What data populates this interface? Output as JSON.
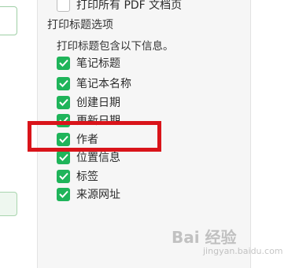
{
  "settings": {
    "top_option": {
      "label": "打印所有 PDF 文档页",
      "checked": false
    },
    "section_title": "打印标题选项",
    "section_desc": "打印标题包含以下信息。",
    "options": [
      {
        "label": "笔记标题",
        "checked": true
      },
      {
        "label": "笔记本名称",
        "checked": true
      },
      {
        "label": "创建日期",
        "checked": true
      },
      {
        "label": "更新日期",
        "checked": true
      },
      {
        "label": "作者",
        "checked": true
      },
      {
        "label": "位置信息",
        "checked": true
      },
      {
        "label": "标签",
        "checked": true
      },
      {
        "label": "来源网址",
        "checked": true
      }
    ]
  },
  "watermark": {
    "text": "Bai 经验",
    "sub": "jingyan.baidu.com"
  },
  "colors": {
    "checkbox": "#1fb45a",
    "highlight": "#d9141a"
  }
}
